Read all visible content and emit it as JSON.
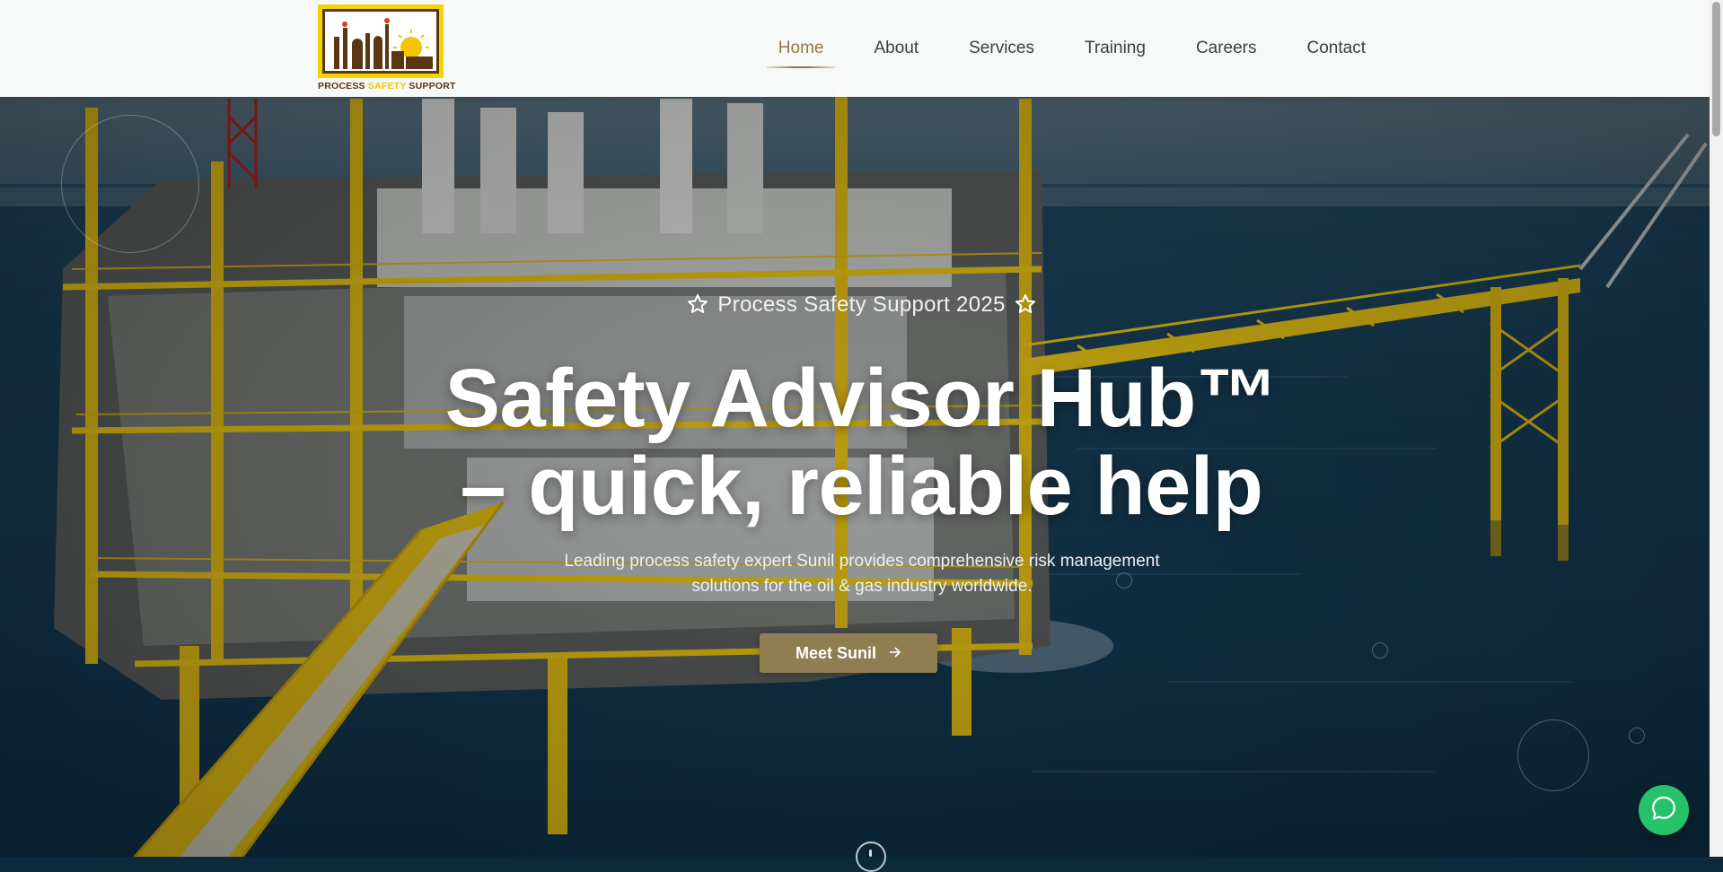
{
  "brand": {
    "logo_text_left": "PROCESS ",
    "logo_text_mid": "SAFETY",
    "logo_text_right": " SUPPORT"
  },
  "nav": {
    "items": [
      {
        "label": "Home",
        "active": true
      },
      {
        "label": "About",
        "active": false
      },
      {
        "label": "Services",
        "active": false
      },
      {
        "label": "Training",
        "active": false
      },
      {
        "label": "Careers",
        "active": false
      },
      {
        "label": "Contact",
        "active": false
      }
    ]
  },
  "hero": {
    "badge": "Process Safety Support 2025",
    "headline_line1": "Safety Advisor Hub™",
    "headline_line2": "– quick, reliable help",
    "subtext_line1": "Leading process safety expert Sunil provides comprehensive risk management",
    "subtext_line2": "solutions for the oil & gas industry worldwide.",
    "cta_label": "Meet Sunil"
  },
  "colors": {
    "accent_gold": "#8f7a44",
    "cta_bg": "#8f7e52",
    "logo_yellow": "#f3d400",
    "logo_brown": "#5a3712",
    "chat_green": "#25c26a"
  },
  "icons": {
    "badge_left": "star-outline-icon",
    "badge_right": "star-outline-icon",
    "cta": "arrow-right-icon",
    "chat": "chat-bubble-icon",
    "scroll": "scroll-down-icon"
  }
}
